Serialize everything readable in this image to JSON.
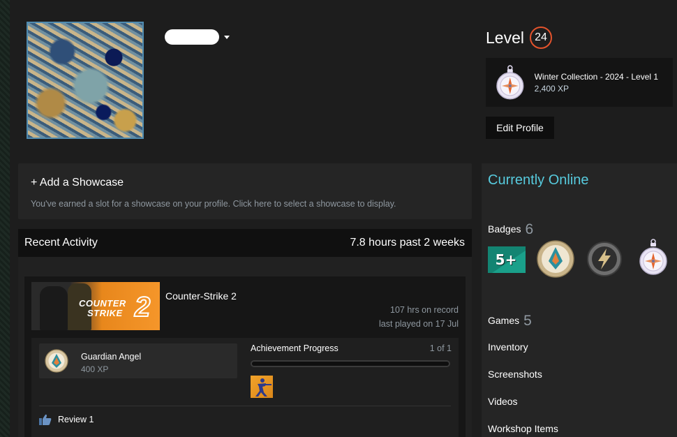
{
  "profile": {
    "level_label": "Level",
    "level_value": "24",
    "edit_profile_label": "Edit Profile"
  },
  "featured_badge": {
    "name": "Winter Collection - 2024 - Level 1",
    "xp": "2,400 XP",
    "icon": "compass-badge-icon"
  },
  "showcase": {
    "title": "+ Add a Showcase",
    "description": "You've earned a slot for a showcase on your profile. Click here to select a showcase to display."
  },
  "recent_activity": {
    "title": "Recent Activity",
    "hours": "7.8 hours past 2 weeks",
    "game": {
      "name": "Counter-Strike 2",
      "capsule_line1": "COUNTER",
      "capsule_line2": "STRIKE",
      "capsule_number": "2",
      "hours_on_record": "107 hrs on record",
      "last_played": "last played on 17 Jul",
      "achievement": {
        "name": "Guardian Angel",
        "xp": "400 XP"
      },
      "achievement_progress_label": "Achievement Progress",
      "achievement_progress_count": "1 of 1",
      "achievement_progress_fraction": 1.0,
      "review_label": "Review 1"
    }
  },
  "sidebar": {
    "status": "Currently Online",
    "badges_label": "Badges",
    "badges_count": "6",
    "badge_five_label": "5+",
    "badges": [
      "five-plus-badge-icon",
      "guardian-medal-icon",
      "lightning-coin-icon",
      "compass-badge-icon"
    ],
    "games_label": "Games",
    "games_count": "5",
    "links": [
      "Inventory",
      "Screenshots",
      "Videos",
      "Workshop Items"
    ]
  },
  "colors": {
    "accent_online": "#57cbde",
    "level_ring": "#e4532c",
    "badge_teal": "#1aa08a"
  }
}
